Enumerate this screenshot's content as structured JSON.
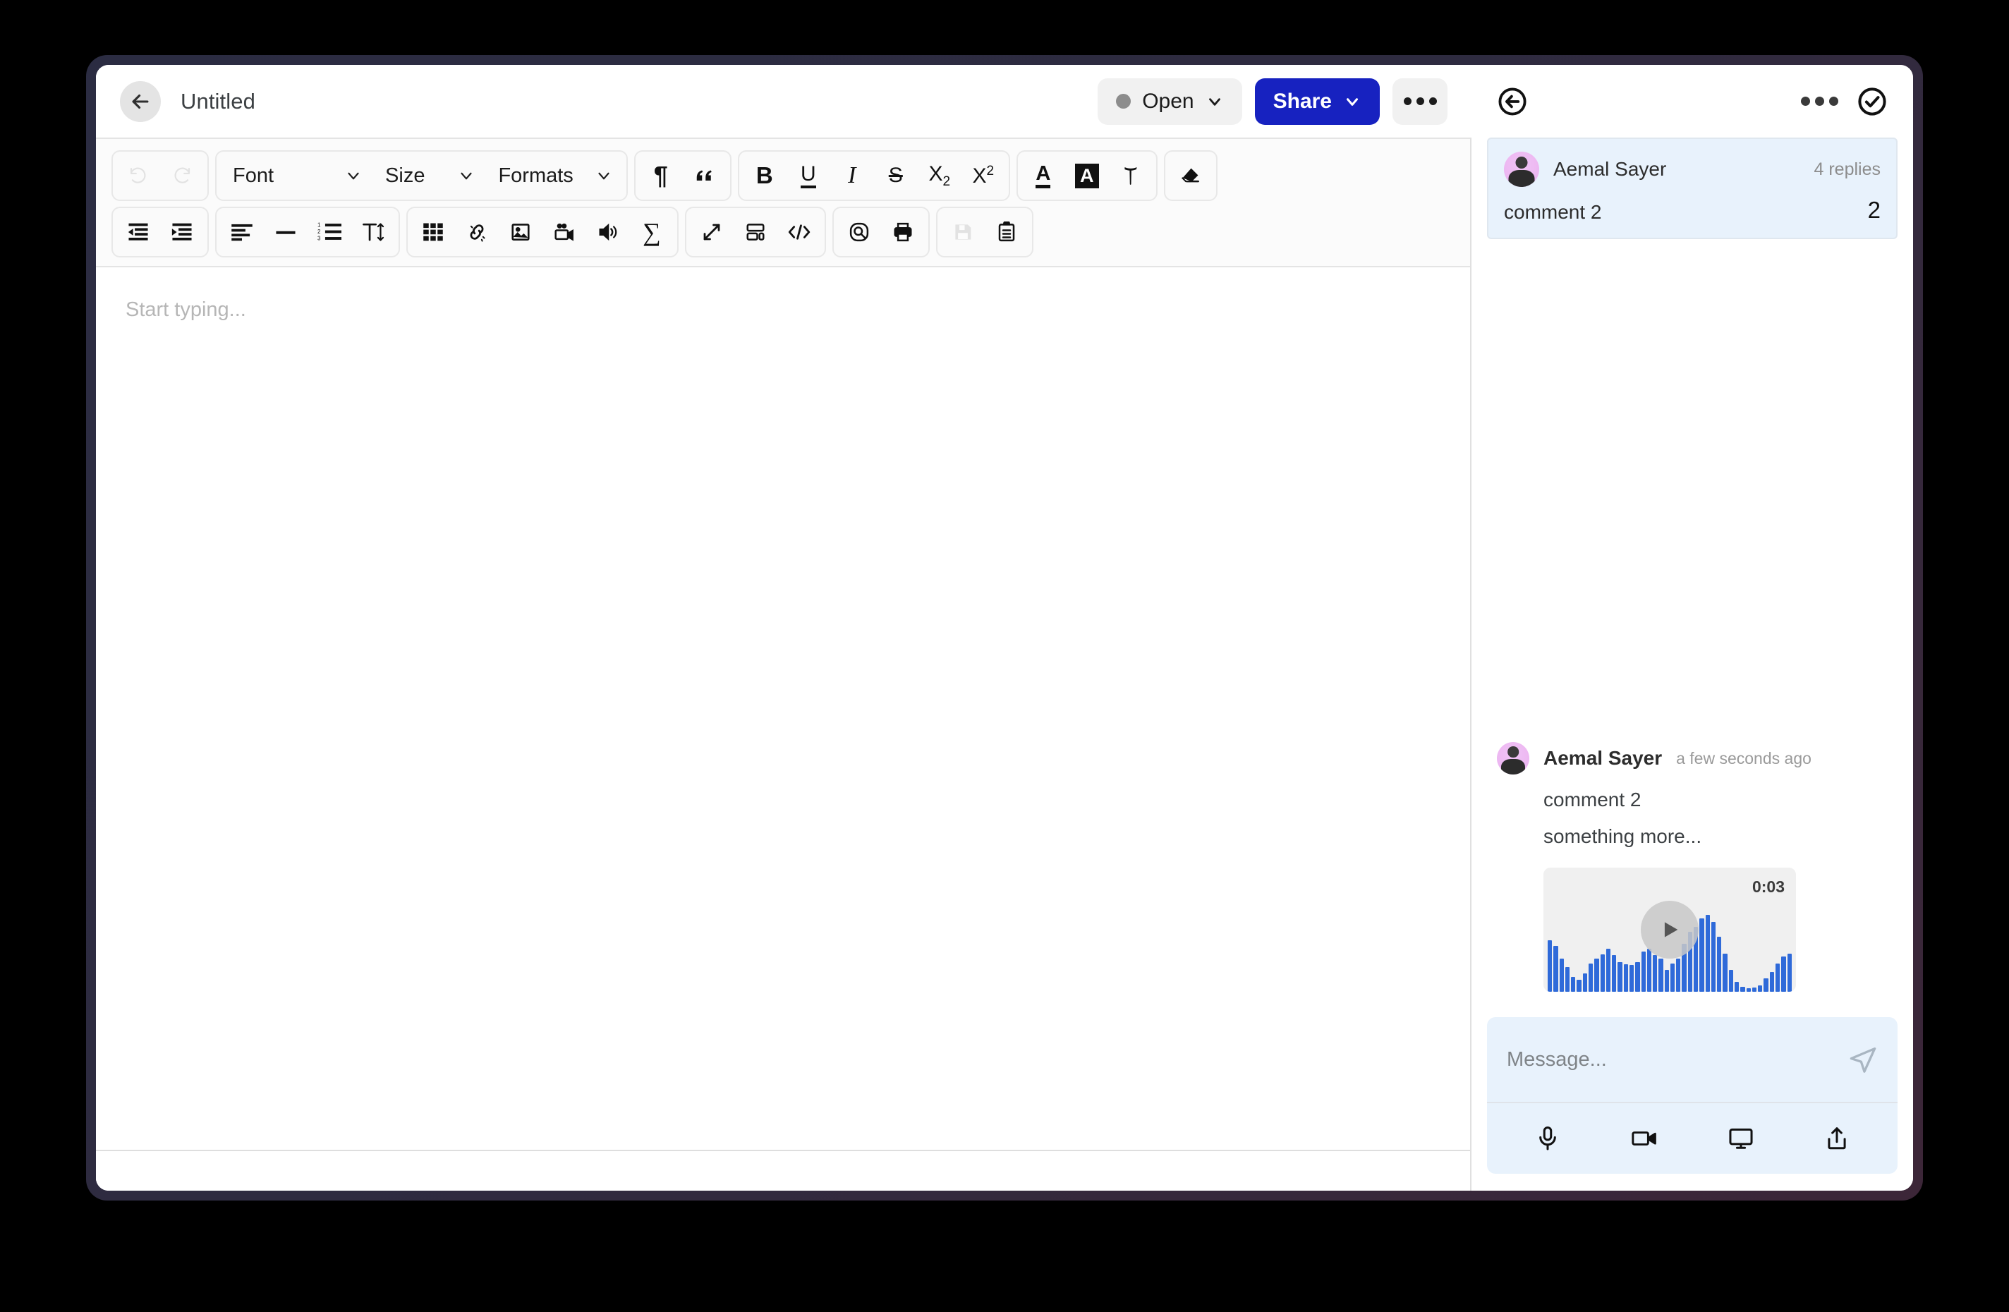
{
  "header": {
    "back_icon": "arrow-left-icon",
    "title": "Untitled",
    "status_label": "Open",
    "status_dot_color": "#8c8c8c",
    "status_chevron_icon": "chevron-down-icon",
    "share_label": "Share",
    "share_chevron_icon": "chevron-down-icon",
    "share_color": "#1722c0",
    "more_icon": "ellipsis-icon"
  },
  "toolbar": {
    "row1": [
      {
        "group": "history",
        "items": [
          {
            "name": "undo-button",
            "icon": "undo-icon",
            "label": "",
            "disabled": true
          },
          {
            "name": "redo-button",
            "icon": "redo-icon",
            "label": "",
            "disabled": true
          }
        ]
      },
      {
        "group": "typography",
        "items": [
          {
            "name": "font-select",
            "icon": "chevron-down-icon",
            "label": "Font",
            "disabled": false
          },
          {
            "name": "size-select",
            "icon": "chevron-down-icon",
            "label": "Size",
            "disabled": false
          },
          {
            "name": "formats-select",
            "icon": "chevron-down-icon",
            "label": "Formats",
            "disabled": false
          }
        ]
      },
      {
        "group": "blocks",
        "items": [
          {
            "name": "paragraph-button",
            "icon": "pilcrow-icon",
            "label": "¶",
            "disabled": false
          },
          {
            "name": "blockquote-button",
            "icon": "quote-icon",
            "label": "“",
            "disabled": false
          }
        ]
      },
      {
        "group": "inline-format",
        "items": [
          {
            "name": "bold-button",
            "icon": "bold-icon",
            "label": "B",
            "disabled": false
          },
          {
            "name": "underline-button",
            "icon": "underline-icon",
            "label": "U",
            "disabled": false
          },
          {
            "name": "italic-button",
            "icon": "italic-icon",
            "label": "I",
            "disabled": false
          },
          {
            "name": "strikethrough-button",
            "icon": "strikethrough-icon",
            "label": "S",
            "disabled": false
          },
          {
            "name": "subscript-button",
            "icon": "subscript-icon",
            "label": "X",
            "disabled": false
          },
          {
            "name": "superscript-button",
            "icon": "superscript-icon",
            "label": "X",
            "disabled": false
          }
        ]
      },
      {
        "group": "color",
        "items": [
          {
            "name": "text-color-button",
            "icon": "text-color-icon",
            "label": "A",
            "disabled": false
          },
          {
            "name": "highlight-color-button",
            "icon": "highlight-color-icon",
            "label": "A",
            "disabled": false
          },
          {
            "name": "brush-format-button",
            "icon": "format-painter-icon",
            "label": "",
            "disabled": false
          }
        ]
      },
      {
        "group": "clear",
        "items": [
          {
            "name": "clear-formatting-button",
            "icon": "eraser-icon",
            "label": "",
            "disabled": false
          }
        ]
      }
    ],
    "row2": [
      {
        "group": "indent",
        "items": [
          {
            "name": "outdent-button",
            "icon": "outdent-icon"
          },
          {
            "name": "indent-button",
            "icon": "indent-icon"
          }
        ]
      },
      {
        "group": "paragraph",
        "items": [
          {
            "name": "align-button",
            "icon": "align-left-icon"
          },
          {
            "name": "horizontal-rule-button",
            "icon": "horizontal-rule-icon"
          },
          {
            "name": "numbered-list-button",
            "icon": "ordered-list-icon"
          },
          {
            "name": "line-height-button",
            "icon": "line-height-icon"
          }
        ]
      },
      {
        "group": "insert",
        "items": [
          {
            "name": "table-button",
            "icon": "table-icon"
          },
          {
            "name": "unlink-button",
            "icon": "broken-link-icon"
          },
          {
            "name": "image-button",
            "icon": "image-icon"
          },
          {
            "name": "video-button",
            "icon": "video-camera-icon"
          },
          {
            "name": "audio-button",
            "icon": "speaker-icon"
          },
          {
            "name": "formula-button",
            "icon": "sigma-icon"
          }
        ]
      },
      {
        "group": "view",
        "items": [
          {
            "name": "fullscreen-button",
            "icon": "expand-arrows-icon"
          },
          {
            "name": "template-button",
            "icon": "layout-icon"
          },
          {
            "name": "source-code-button",
            "icon": "code-icon"
          }
        ]
      },
      {
        "group": "tools",
        "items": [
          {
            "name": "find-replace-button",
            "icon": "search-icon"
          },
          {
            "name": "print-button",
            "icon": "printer-icon"
          }
        ]
      },
      {
        "group": "file",
        "items": [
          {
            "name": "save-button",
            "icon": "floppy-disk-icon",
            "disabled": true
          },
          {
            "name": "paste-button",
            "icon": "clipboard-icon",
            "disabled": false
          }
        ]
      }
    ]
  },
  "editor": {
    "placeholder": "Start typing..."
  },
  "sidebar": {
    "back_icon": "circle-arrow-left-icon",
    "more_icon": "ellipsis-icon",
    "resolve_icon": "circle-check-icon",
    "comments": [
      {
        "author": "Aemal Sayer",
        "avatar": "user-avatar",
        "replies_label": "4 replies",
        "text": "comment 2",
        "count": "2"
      }
    ],
    "thread": {
      "author": "Aemal Sayer",
      "avatar": "user-avatar",
      "timestamp": "a few seconds ago",
      "lines": [
        "comment 2",
        "something more..."
      ],
      "audio": {
        "duration": "0:03",
        "play_icon": "play-icon",
        "wave_color": "#2f6ad9",
        "levels": [
          62,
          55,
          40,
          30,
          18,
          14,
          22,
          34,
          40,
          45,
          52,
          44,
          36,
          33,
          32,
          36,
          48,
          52,
          44,
          40,
          26,
          34,
          40,
          58,
          72,
          78,
          88,
          92,
          84,
          66,
          46,
          26,
          12,
          6,
          4,
          5,
          8,
          16,
          24,
          34,
          42,
          46
        ]
      }
    },
    "composer": {
      "placeholder": "Message...",
      "value": "",
      "send_icon": "send-icon",
      "tools": [
        {
          "name": "record-audio-button",
          "icon": "microphone-icon"
        },
        {
          "name": "record-video-button",
          "icon": "video-camera-icon"
        },
        {
          "name": "share-screen-button",
          "icon": "monitor-icon"
        },
        {
          "name": "upload-file-button",
          "icon": "upload-icon"
        }
      ]
    }
  }
}
